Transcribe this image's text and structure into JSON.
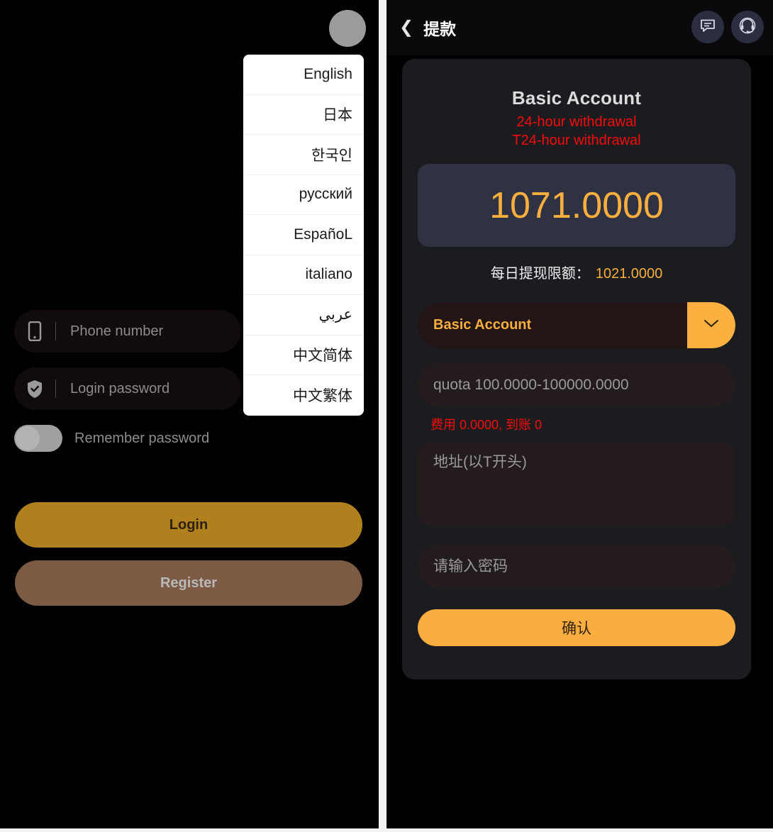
{
  "left_panel": {
    "avatar_icon": "avatar-circle",
    "language_menu": {
      "items": [
        {
          "label": "English"
        },
        {
          "label": "日本"
        },
        {
          "label": "한국인"
        },
        {
          "label": "русский"
        },
        {
          "label": "EspañoL"
        },
        {
          "label": "italiano"
        },
        {
          "label": "عربي"
        },
        {
          "label": "中文简体"
        },
        {
          "label": "中文繁体"
        }
      ]
    },
    "form": {
      "phone": {
        "icon": "phone-icon",
        "value": "",
        "placeholder": "Phone number"
      },
      "password": {
        "icon": "shield-check-icon",
        "value": "",
        "placeholder": "Login password"
      },
      "remember": {
        "label": "Remember password",
        "checked": false
      },
      "login_label": "Login",
      "register_label": "Register"
    }
  },
  "right_panel": {
    "header": {
      "back_icon": "chevron-left-icon",
      "title": "提款",
      "chat_icon": "chat-bubble-icon",
      "support_icon": "headset-support-icon"
    },
    "withdraw": {
      "account_title": "Basic Account",
      "notice_line1": "24-hour withdrawal",
      "notice_line2": "T24-hour withdrawal",
      "balance": "1071.0000",
      "daily_limit_label": "每日提现限额：",
      "daily_limit_value": "1021.0000",
      "account_select": {
        "value": "Basic Account",
        "arrow_icon": "chevron-down-icon"
      },
      "amount": {
        "value": "",
        "placeholder": "quota 100.0000-100000.0000"
      },
      "fee_note": "费用 0.0000, 到账 0",
      "address": {
        "value": "",
        "placeholder": "地址(以T开头)"
      },
      "pay_password": {
        "value": "",
        "placeholder": "请输入密码"
      },
      "confirm_label": "确认"
    }
  },
  "colors": {
    "accent_amber": "#f9ae3d",
    "accent_orange": "#fbad3f",
    "alert_red": "#f50b0b",
    "login_gold": "#b0801f",
    "register_brown": "#7d5a44",
    "balance_card": "#2f3243"
  }
}
